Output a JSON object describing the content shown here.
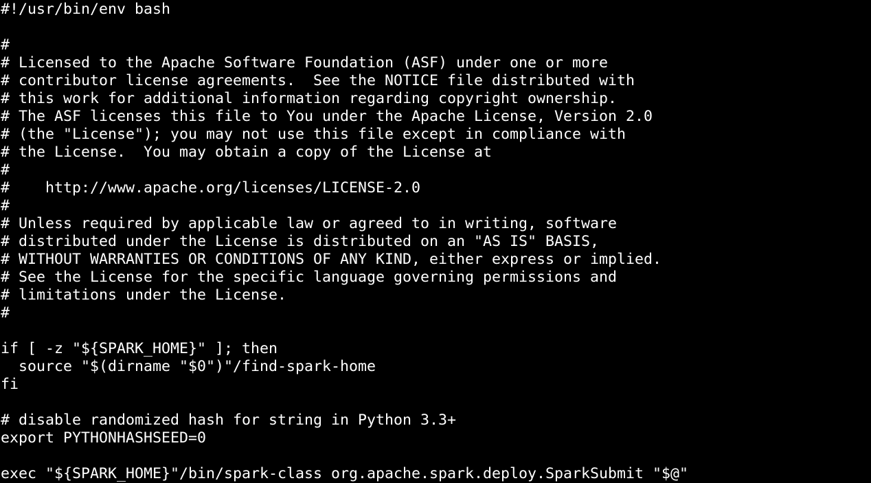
{
  "terminal": {
    "background": "#000000",
    "foreground": "#ffffff",
    "lines": [
      "#!/usr/bin/env bash",
      "",
      "#",
      "# Licensed to the Apache Software Foundation (ASF) under one or more",
      "# contributor license agreements.  See the NOTICE file distributed with",
      "# this work for additional information regarding copyright ownership.",
      "# The ASF licenses this file to You under the Apache License, Version 2.0",
      "# (the \"License\"); you may not use this file except in compliance with",
      "# the License.  You may obtain a copy of the License at",
      "#",
      "#    http://www.apache.org/licenses/LICENSE-2.0",
      "#",
      "# Unless required by applicable law or agreed to in writing, software",
      "# distributed under the License is distributed on an \"AS IS\" BASIS,",
      "# WITHOUT WARRANTIES OR CONDITIONS OF ANY KIND, either express or implied.",
      "# See the License for the specific language governing permissions and",
      "# limitations under the License.",
      "#",
      "",
      "if [ -z \"${SPARK_HOME}\" ]; then",
      "  source \"$(dirname \"$0\")\"/find-spark-home",
      "fi",
      "",
      "# disable randomized hash for string in Python 3.3+",
      "export PYTHONHASHSEED=0",
      "",
      "exec \"${SPARK_HOME}\"/bin/spark-class org.apache.spark.deploy.SparkSubmit \"$@\""
    ]
  }
}
